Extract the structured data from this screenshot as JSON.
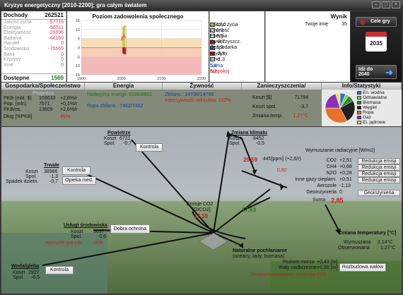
{
  "window": {
    "title": "Kryzys energetyczny [2010-2200]; gra całym światem"
  },
  "budget": {
    "header_label": "Dochody",
    "header_value": "262521",
    "rows": [
      {
        "label": "Jakość życia",
        "value": "-57716"
      },
      {
        "label": "Energia",
        "value": "-56511"
      },
      {
        "label": "Efektywność",
        "value": "-26896"
      },
      {
        "label": "Badania",
        "value": "-44160"
      },
      {
        "label": "Handel",
        "value": "0"
      },
      {
        "label": "Środowisko",
        "value": "-75569"
      },
      {
        "label": "Bank",
        "value": "0"
      },
      {
        "label": "Kryzysy",
        "value": "0"
      },
      {
        "label": "Inne",
        "value": "0"
      }
    ],
    "footer_label": "Dostępne",
    "footer_value": "1569"
  },
  "chart_data": {
    "type": "line",
    "title": "Poziom zadowolenia społecznego",
    "x_ticks": [
      "1900",
      "2000",
      "2100",
      "2200"
    ],
    "y_ticks": [
      "15",
      "10",
      "5",
      "0",
      "-5",
      "-10",
      "-15"
    ],
    "ylim": [
      -15,
      15
    ],
    "xlim": [
      1900,
      2200
    ],
    "bands": [
      {
        "from": 5,
        "to": 15,
        "color": "#ffffff"
      },
      {
        "from": 0,
        "to": 5,
        "color": "#f9dfb6"
      },
      {
        "from": -5,
        "to": 0,
        "color": "#f9ccb4"
      },
      {
        "from": -15,
        "to": -5,
        "color": "#f3b8b8"
      }
    ],
    "bars": [
      {
        "name": "Jakość życia",
        "color": "#f6ef4c",
        "x": [
          2004,
          2006,
          2008,
          2010
        ],
        "y": [
          11.5,
          11.8,
          12.0,
          12.0
        ]
      },
      {
        "name": "Zanieczyszcz.",
        "color": "#e01c1c",
        "x": [
          2004,
          2006,
          2008,
          2010
        ],
        "y": [
          -3.0,
          -3.4,
          -3.6,
          -3.7
        ]
      }
    ],
    "line": {
      "x": [
        2000,
        2002,
        2004,
        2006,
        2008,
        2010
      ],
      "y": [
        4.2,
        6.0,
        4.5,
        7.0,
        6.2,
        5.8
      ],
      "color": "#e05a5a"
    }
  },
  "legend": {
    "rows": [
      {
        "label": "Jakość życia",
        "color": "#f6ef4c",
        "value": "12,0"
      },
      {
        "label": "Żywność",
        "color": "#ffffff",
        "value": "0,0"
      },
      {
        "label": "Energia",
        "color": "#ffffff",
        "value": "0,0"
      },
      {
        "label": "Zanieczyszcz.",
        "color": "#e01c1c",
        "value": "-3,7"
      },
      {
        "label": "Gospodarka",
        "color": "#2f6bd8",
        "value": "1,9"
      },
      {
        "label": "Kryzysy",
        "color": "#e01c1c",
        "value": "-3,3"
      },
      {
        "label": "Inne",
        "color": "#ffffff",
        "value": "-1,3"
      }
    ],
    "sum_label": "Suma",
    "sum_value": "5,8",
    "unrest_label": "Niepokój",
    "unrest_value": "6,2"
  },
  "result": {
    "title": "Wynik",
    "player_label": "Twoje imię",
    "player_value": "35"
  },
  "right": {
    "goals_label": "Cele gry",
    "year": "2035",
    "next_label": "Idź do",
    "next_year": "2040"
  },
  "sections": {
    "economy": {
      "title": "Gospodarka/Społeczeństwo",
      "subtitle": "Prognoza",
      "rows": [
        {
          "label": "PKB (mld. $)",
          "value": "103033",
          "rate": "+2,6%/r"
        },
        {
          "label": "Pop. (mln)",
          "value": "7571",
          "rate": "+0,1%/r"
        },
        {
          "label": "PKB/os.",
          "value": "13609",
          "rate": "+2,6%/r"
        }
      ],
      "debt_label": "Dług [%PKB]",
      "debt_value": "45%"
    },
    "energy": {
      "title": "Energia",
      "line1": "Nadwyżka energii: 9196/8902",
      "line2": "Ropa zbilans.: 7462/7462"
    },
    "food": {
      "title": "Żywność",
      "line1": "Zbilans.: 14798/14798",
      "line2": "Intensywność rolnictwa: 152%"
    },
    "pollution": {
      "title": "Zanieczyszczenia/Środowisko",
      "r1_label": "Koszt [$]",
      "r1_value": "71784",
      "r2_label": "Koszt spol.",
      "r2_value": "-3,7",
      "r3_label": "Zmiana temp.",
      "r3_value": "1,27°C"
    },
    "stats": {
      "title": "Info/Statystyki",
      "pie": [
        {
          "name": "En. wodna",
          "value": 6,
          "color": "#2f6bd8"
        },
        {
          "name": "Odnawialne",
          "value": 4,
          "color": "#7bd84a"
        },
        {
          "name": "Biomasa",
          "value": 7,
          "color": "#2a8a2a"
        },
        {
          "name": "Węgiel",
          "value": 25,
          "color": "#222222"
        },
        {
          "name": "Ropa",
          "value": 33,
          "color": "#e8722c"
        },
        {
          "name": "Gaz",
          "value": 20,
          "color": "#8b2fc0"
        },
        {
          "name": "El. jądrowe",
          "value": 5,
          "color": "#f2e24a"
        }
      ]
    }
  },
  "scene": {
    "air": {
      "title": "Powietrze",
      "cost_label": "Koszt",
      "cost_value": "6721",
      "spol_label": "Spol.",
      "spol_value": "-0,7",
      "button": "Kontrola"
    },
    "durable": {
      "title": "Trwałe",
      "cost_label": "Koszt",
      "cost_value": "38986",
      "spol_label": "Spol.",
      "spol_value": "-1,3",
      "fert_label": "Spadek dzietn.",
      "fert_value": "-0,7",
      "button1": "Kontrola",
      "button2": "Opieka med."
    },
    "climate": {
      "title": "Zmiana klimatu",
      "cost_label": "Koszt",
      "cost_value": "8452",
      "spol_label": "Spol.",
      "spol_value": "-0,5"
    },
    "ppm": {
      "value": "20,59",
      "label": "445[ppm] (+2,6/r)",
      "sub": "0,82"
    },
    "forcing": {
      "title": "Wymuszanie radiacyjne [W/m2]",
      "rows": [
        {
          "label": "CO2",
          "value": "+2,51",
          "button": "Redukcja emisji"
        },
        {
          "label": "CH4",
          "value": "+0,68",
          "button": "Redukcja emisji"
        },
        {
          "label": "N2O",
          "value": "+0,28",
          "button": "Redukcja emisji"
        },
        {
          "label": "Inne gazy cieplarn.",
          "value": "+0,51",
          "button": "Redukcja emisji"
        },
        {
          "label": "Aerozole",
          "value": "-1,13",
          "button": ""
        },
        {
          "label": "Geoinżynieria",
          "value": "0",
          "button": "Geoinżynieria"
        }
      ],
      "sum_label": "Suma",
      "sum_value": "2,85"
    },
    "emissions": {
      "title": "Emisje CO2",
      "unit": "[GtCO2]",
      "value": "17,39",
      "green_value": "17,63"
    },
    "env": {
      "title": "Usługi środowiska",
      "cost_label": "Koszt",
      "cost_value": "9697",
      "spol_label": "Spol.",
      "spol_value": "-0,6",
      "extinct_label": "Wymarłe gatunki",
      "extinct_value": "20%",
      "button": "Dobra ochrona"
    },
    "sinks": {
      "title": "Naturalne pochłanianie",
      "sub": "(oceany, lądy, biomasa)"
    },
    "temp": {
      "title": "Zmiana temperatury [°C]",
      "forced_label": "Wymuszana",
      "forced_value": "2,14°C",
      "observed_label": "Obserwowana",
      "observed_value": "1,27°C"
    },
    "water": {
      "title": "Woda/gleba",
      "cost_label": "Koszt",
      "cost_value": "2927",
      "spol_label": "Spol.",
      "spol_value": "-0,5",
      "button": "Kontrola"
    },
    "sea": {
      "level_label": "Poziom morza",
      "level_value": "+0,43 [m]",
      "wall_label": "Wały nadbrzeżne",
      "wall_value": "+0,50 [m]",
      "acid_label": "Zmiana kwasowości oceanów",
      "acid_value": "31%",
      "button": "Rozbudowa wałów"
    }
  }
}
